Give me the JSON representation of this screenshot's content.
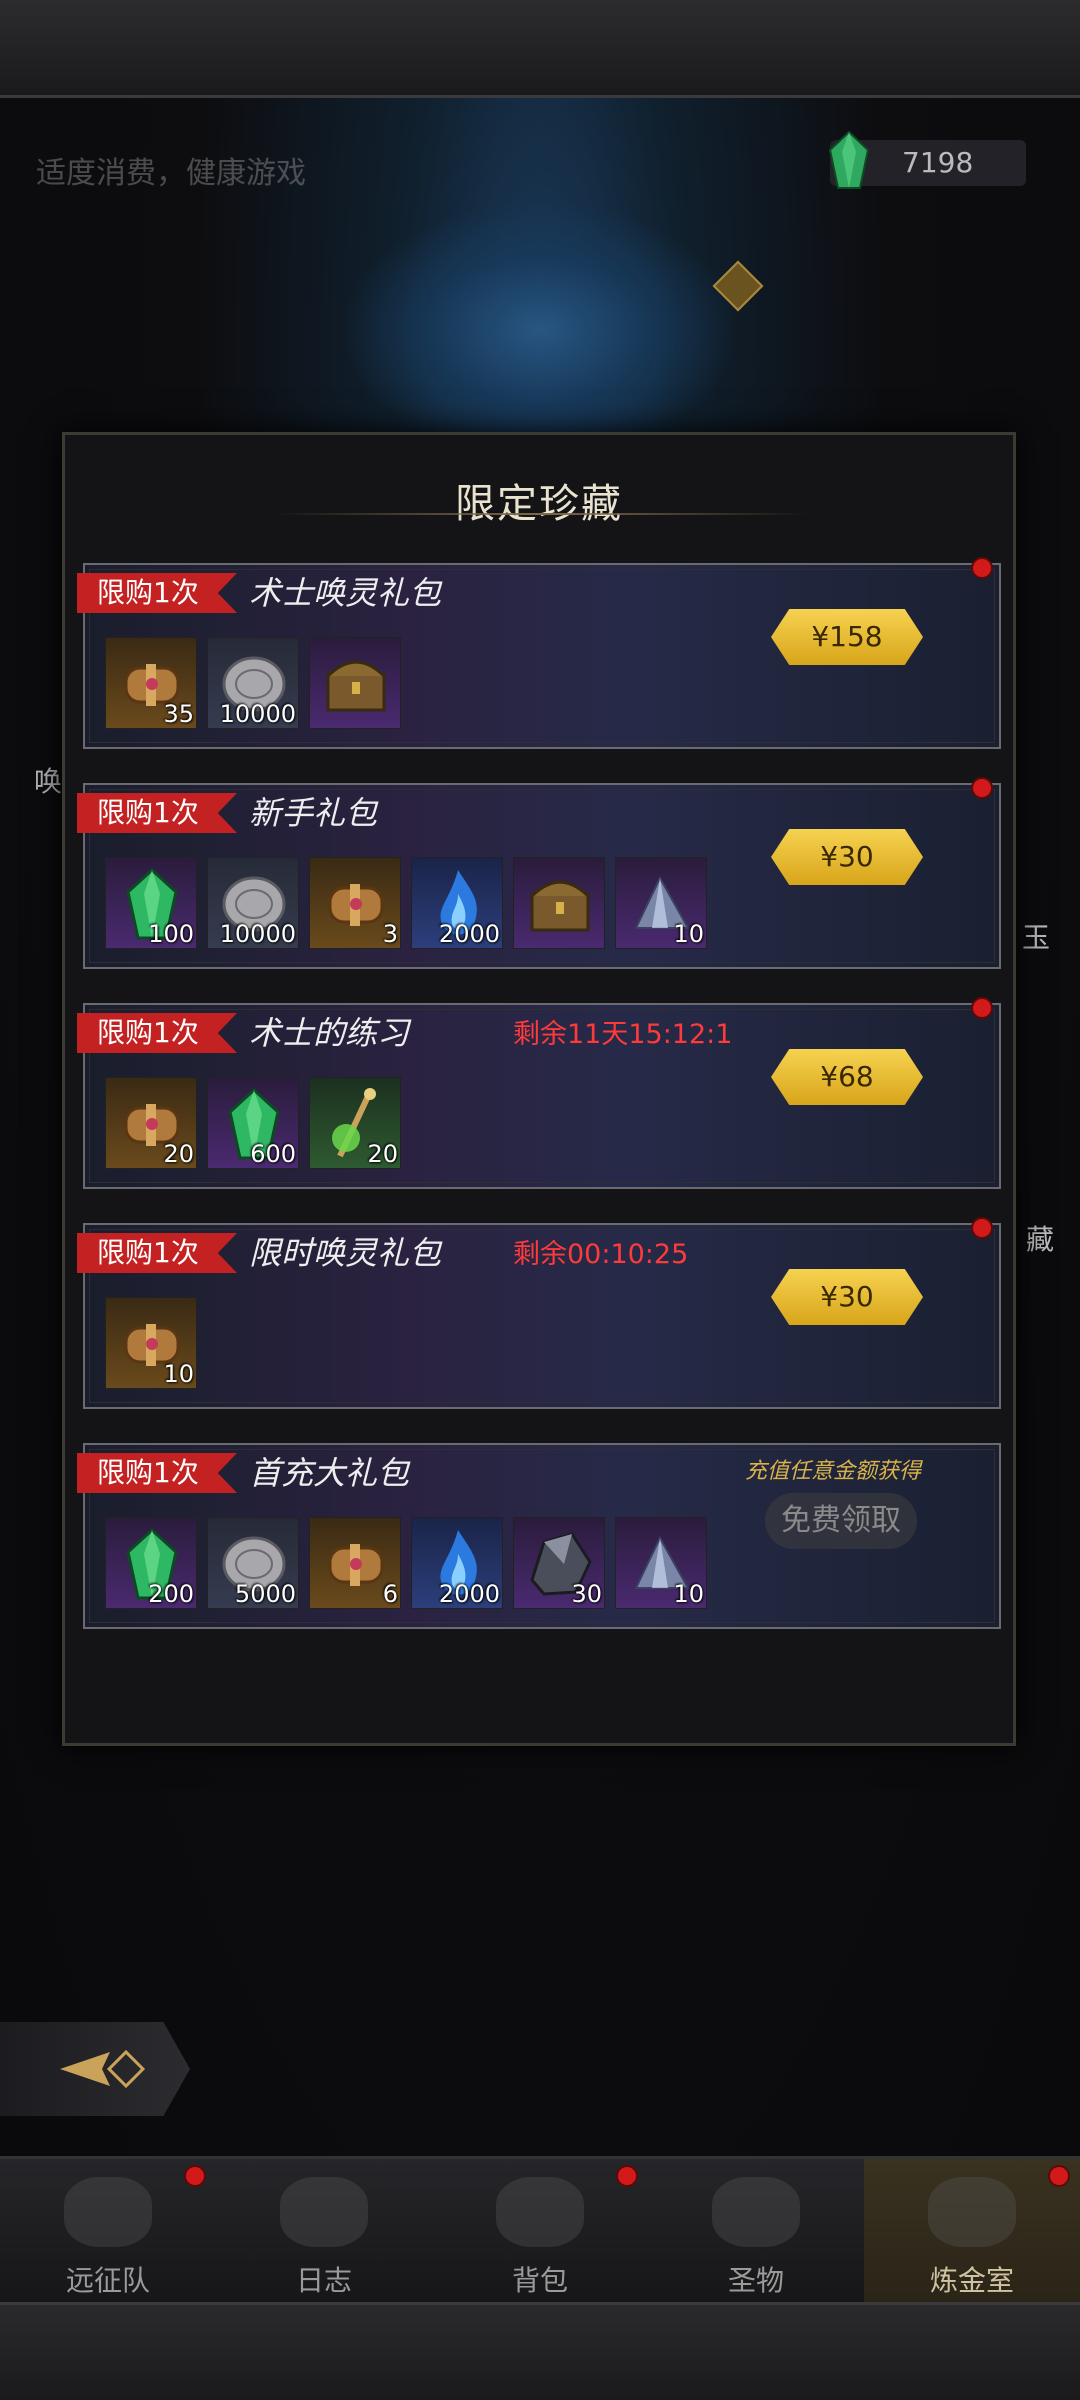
{
  "header": {
    "notice": "适度消费，健康游戏",
    "gems": "7198"
  },
  "side_labels": {
    "left_mid": "唤",
    "right_jade": "玉",
    "right_collect": "藏"
  },
  "modal": {
    "title": "限定珍藏",
    "packages": [
      {
        "limit_tag": "限购1次",
        "name": "术士唤灵礼包",
        "timer": "",
        "price": "¥158",
        "has_dot": true,
        "items": [
          {
            "icon": "scroll-icon",
            "quality": "orange",
            "count": "35"
          },
          {
            "icon": "silver-coin-icon",
            "quality": "gray",
            "count": "10000"
          },
          {
            "icon": "treasure-chest-icon",
            "quality": "purple",
            "count": ""
          }
        ]
      },
      {
        "limit_tag": "限购1次",
        "name": "新手礼包",
        "timer": "",
        "price": "¥30",
        "has_dot": true,
        "items": [
          {
            "icon": "green-gem-icon",
            "quality": "purple",
            "count": "100"
          },
          {
            "icon": "silver-coin-icon",
            "quality": "gray",
            "count": "10000"
          },
          {
            "icon": "scroll-icon",
            "quality": "orange",
            "count": "3"
          },
          {
            "icon": "blue-flame-icon",
            "quality": "blue",
            "count": "2000"
          },
          {
            "icon": "treasure-chest-icon",
            "quality": "purple",
            "count": ""
          },
          {
            "icon": "crystal-shard-icon",
            "quality": "purple",
            "count": "10"
          }
        ]
      },
      {
        "limit_tag": "限购1次",
        "name": "术士的练习",
        "timer": "剩余11天15:12:1",
        "price": "¥68",
        "has_dot": true,
        "items": [
          {
            "icon": "scroll-icon",
            "quality": "orange",
            "count": "20"
          },
          {
            "icon": "green-gem-icon",
            "quality": "purple",
            "count": "600"
          },
          {
            "icon": "green-staff-icon",
            "quality": "green",
            "count": "20"
          }
        ]
      },
      {
        "limit_tag": "限购1次",
        "name": "限时唤灵礼包",
        "timer": "剩余00:10:25",
        "price": "¥30",
        "has_dot": true,
        "items": [
          {
            "icon": "scroll-icon",
            "quality": "orange",
            "count": "10"
          }
        ]
      },
      {
        "limit_tag": "限购1次",
        "name": "首充大礼包",
        "timer": "",
        "free_note": "充值任意金额获得",
        "free_button": "免费领取",
        "has_dot": false,
        "items": [
          {
            "icon": "green-gem-icon",
            "quality": "purple",
            "count": "200"
          },
          {
            "icon": "silver-coin-icon",
            "quality": "gray",
            "count": "5000"
          },
          {
            "icon": "scroll-icon",
            "quality": "orange",
            "count": "6"
          },
          {
            "icon": "blue-flame-icon",
            "quality": "blue",
            "count": "2000"
          },
          {
            "icon": "dark-ore-icon",
            "quality": "purple",
            "count": "30"
          },
          {
            "icon": "crystal-shard-icon",
            "quality": "purple",
            "count": "10"
          }
        ]
      }
    ]
  },
  "nav": [
    {
      "label": "远征队",
      "icon": "viking-helmet-icon",
      "has_dot": true,
      "active": false
    },
    {
      "label": "日志",
      "icon": "map-scroll-icon",
      "has_dot": false,
      "active": false
    },
    {
      "label": "背包",
      "icon": "backpack-icon",
      "has_dot": true,
      "active": false
    },
    {
      "label": "圣物",
      "icon": "chalice-icon",
      "has_dot": false,
      "active": false
    },
    {
      "label": "炼金室",
      "icon": "alchemy-icon",
      "has_dot": true,
      "active": true
    }
  ],
  "colors": {
    "tag_red": "#c42222",
    "price_gold": "#f6d250",
    "timer_red": "#ff3a3a"
  }
}
